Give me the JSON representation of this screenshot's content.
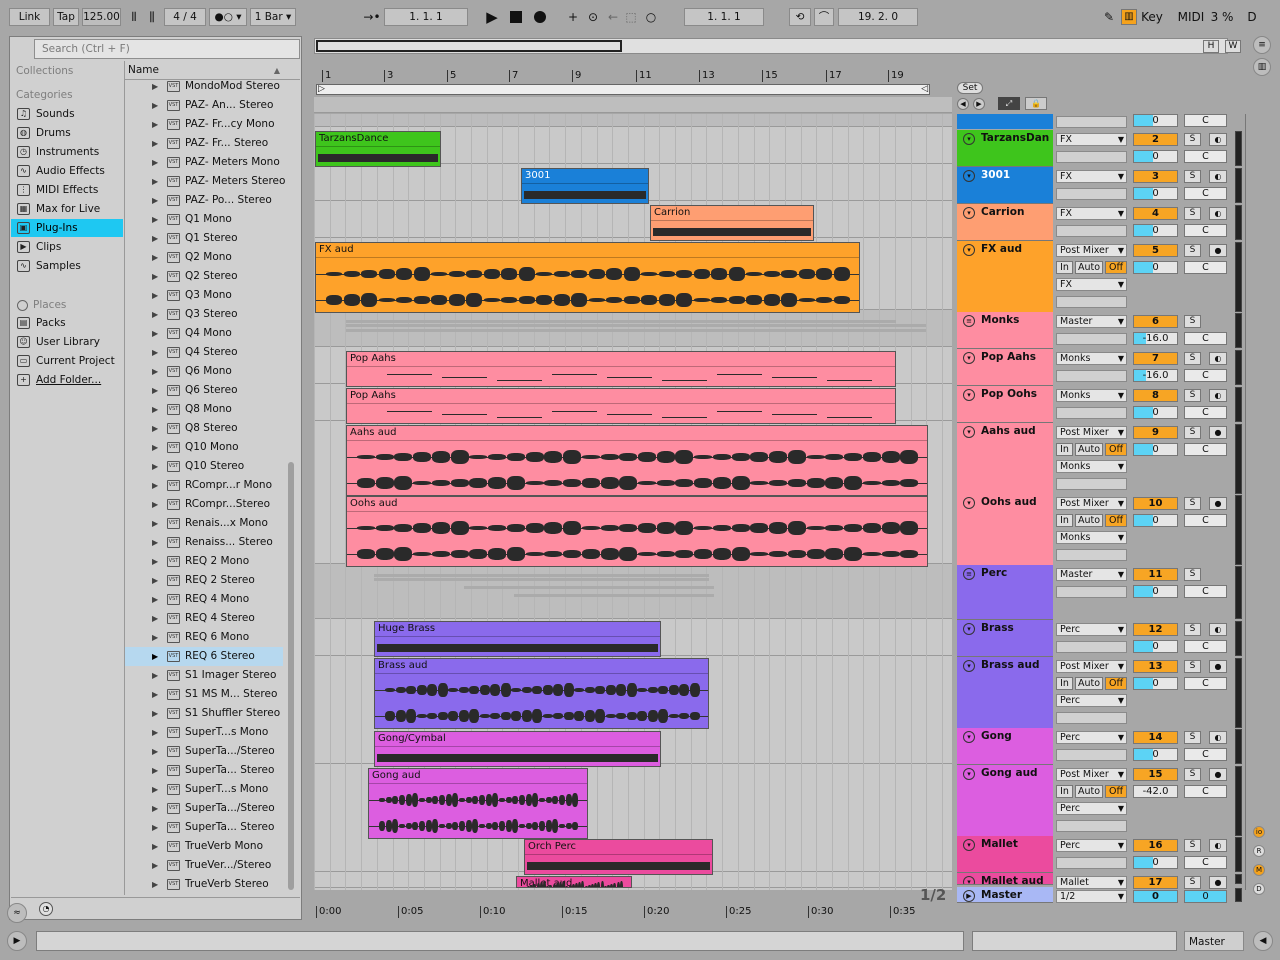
{
  "toolbar": {
    "link": "Link",
    "tap": "Tap",
    "tempo": "125.00",
    "meter_num": "4",
    "meter_den": "4",
    "quantize": "1 Bar",
    "position": "1.   1.   1",
    "loop_start": "1.   1.   1",
    "loop_length": "19.   2.   0",
    "key": "Key",
    "midi": "MIDI",
    "cpu": "3 %",
    "disk": "D"
  },
  "browser": {
    "search_placeholder": "Search (Ctrl + F)",
    "collections": "Collections",
    "categories_label": "Categories",
    "places_label": "Places",
    "name_header": "Name",
    "categories": [
      {
        "label": "Sounds",
        "icon": "note-icon"
      },
      {
        "label": "Drums",
        "icon": "drum-icon"
      },
      {
        "label": "Instruments",
        "icon": "clock-icon"
      },
      {
        "label": "Audio Effects",
        "icon": "wave-icon"
      },
      {
        "label": "MIDI Effects",
        "icon": "midi-icon"
      },
      {
        "label": "Max for Live",
        "icon": "grid-icon"
      },
      {
        "label": "Plug-Ins",
        "icon": "plugin-icon"
      },
      {
        "label": "Clips",
        "icon": "play-icon"
      },
      {
        "label": "Samples",
        "icon": "wave-icon"
      }
    ],
    "places": [
      {
        "label": "Packs",
        "icon": "box-icon"
      },
      {
        "label": "User Library",
        "icon": "user-icon"
      },
      {
        "label": "Current Project",
        "icon": "file-icon"
      },
      {
        "label": "Add Folder...",
        "icon": "plus-icon"
      }
    ],
    "plugin_badge": "VST",
    "items": [
      "MondoMod Stereo",
      "PAZ- An... Stereo",
      "PAZ- Fr...cy Mono",
      "PAZ- Fr... Stereo",
      "PAZ- Meters Mono",
      "PAZ- Meters Stereo",
      "PAZ- Po... Stereo",
      "Q1 Mono",
      "Q1 Stereo",
      "Q2 Mono",
      "Q2 Stereo",
      "Q3 Mono",
      "Q3 Stereo",
      "Q4 Mono",
      "Q4 Stereo",
      "Q6 Mono",
      "Q6 Stereo",
      "Q8 Mono",
      "Q8 Stereo",
      "Q10 Mono",
      "Q10 Stereo",
      "RCompr...r Mono",
      "RCompr...Stereo",
      "Renais...x Mono",
      "Renaiss... Stereo",
      "REQ 2 Mono",
      "REQ 2 Stereo",
      "REQ 4 Mono",
      "REQ 4 Stereo",
      "REQ 6 Mono",
      "REQ 6 Stereo",
      "S1 Imager Stereo",
      "S1 MS M... Stereo",
      "S1 Shuffler Stereo",
      "SuperT...s Mono",
      "SuperTa.../Stereo",
      "SuperTa... Stereo",
      "SuperT...s Mono",
      "SuperTa.../Stereo",
      "SuperTa... Stereo",
      "TrueVerb Mono",
      "TrueVer.../Stereo",
      "TrueVerb Stereo"
    ],
    "selected_item": "REQ 6 Stereo"
  },
  "arrangement": {
    "ruler": [
      "1",
      "3",
      "5",
      "7",
      "9",
      "11",
      "13",
      "15",
      "17",
      "19"
    ],
    "times": [
      "0:00",
      "0:05",
      "0:10",
      "0:15",
      "0:20",
      "0:25",
      "0:30",
      "0:35"
    ],
    "set_label": "Set",
    "page": "1/2",
    "h_btn": "H",
    "w_btn": "W"
  },
  "clips": [
    {
      "name": "TarzansDance",
      "color": "#3ec51c",
      "kind": "midi"
    },
    {
      "name": "3001",
      "color": "#1a80d8",
      "kind": "midi"
    },
    {
      "name": "Carrion",
      "color": "#fe9e72",
      "kind": "midi"
    },
    {
      "name": "FX aud",
      "color": "#fea22a",
      "kind": "audio"
    },
    {
      "name": "Pop Aahs",
      "color": "#fe8da1",
      "kind": "midi"
    },
    {
      "name": "Pop Aahs",
      "color": "#fe8da1",
      "kind": "midi"
    },
    {
      "name": "Aahs aud",
      "color": "#fe8da1",
      "kind": "audio"
    },
    {
      "name": "Oohs aud",
      "color": "#fe8da1",
      "kind": "audio"
    },
    {
      "name": "Huge Brass",
      "color": "#8a6aec",
      "kind": "midi"
    },
    {
      "name": "Brass aud",
      "color": "#8a6aec",
      "kind": "audio"
    },
    {
      "name": "Gong/Cymbal",
      "color": "#dc5ee0",
      "kind": "midi"
    },
    {
      "name": "Gong aud",
      "color": "#dc5ee0",
      "kind": "audio"
    },
    {
      "name": "Orch Perc",
      "color": "#eb4b9e",
      "kind": "midi"
    },
    {
      "name": "Mallet aud",
      "color": "#eb4b9e",
      "kind": "audio"
    }
  ],
  "tracks": [
    {
      "name": "TarzansDan",
      "color": "#3ec51c",
      "route": "FX",
      "num": "2",
      "vol": "0",
      "pan": "C"
    },
    {
      "name": "3001",
      "color": "#1a80d8",
      "route": "FX",
      "num": "3",
      "vol": "0",
      "pan": "C"
    },
    {
      "name": "Carrion",
      "color": "#fe9e72",
      "route": "FX",
      "num": "4",
      "vol": "0",
      "pan": "C"
    },
    {
      "name": "FX aud",
      "color": "#fea22a",
      "route": "Post Mixer",
      "num": "5",
      "vol": "0",
      "pan": "C",
      "out": "FX"
    },
    {
      "name": "Monks",
      "color": "#fe8da1",
      "route": "Master",
      "num": "6",
      "vol": "-16.0",
      "pan": "C"
    },
    {
      "name": "Pop Aahs",
      "color": "#fe8da1",
      "route": "Monks",
      "num": "7",
      "vol": "-16.0",
      "pan": "C"
    },
    {
      "name": "Pop Oohs",
      "color": "#fe8da1",
      "route": "Monks",
      "num": "8",
      "vol": "0",
      "pan": "C"
    },
    {
      "name": "Aahs aud",
      "color": "#fe8da1",
      "route": "Post Mixer",
      "num": "9",
      "vol": "0",
      "pan": "C",
      "out": "Monks"
    },
    {
      "name": "Oohs aud",
      "color": "#fe8da1",
      "route": "Post Mixer",
      "num": "10",
      "vol": "0",
      "pan": "C",
      "out": "Monks"
    },
    {
      "name": "Perc",
      "color": "#8a6aec",
      "route": "Master",
      "num": "11",
      "vol": "0",
      "pan": "C"
    },
    {
      "name": "Brass",
      "color": "#8a6aec",
      "route": "Perc",
      "num": "12",
      "vol": "0",
      "pan": "C"
    },
    {
      "name": "Brass aud",
      "color": "#8a6aec",
      "route": "Post Mixer",
      "num": "13",
      "vol": "0",
      "pan": "C",
      "out": "Perc"
    },
    {
      "name": "Gong",
      "color": "#dc5ee0",
      "route": "Perc",
      "num": "14",
      "vol": "0",
      "pan": "C"
    },
    {
      "name": "Gong aud",
      "color": "#dc5ee0",
      "route": "Post Mixer",
      "num": "15",
      "vol": "-42.0",
      "pan": "C",
      "out": "Perc"
    },
    {
      "name": "Mallet",
      "color": "#eb4b9e",
      "route": "Perc",
      "num": "16",
      "vol": "0",
      "pan": "C"
    },
    {
      "name": "Mallet aud",
      "color": "#eb4b9e",
      "route": "Mallet",
      "num": "17",
      "vol": "",
      "pan": ""
    },
    {
      "name": "Master",
      "color": "#a9b8f5",
      "route": "1/2",
      "num": "0",
      "vol": "0",
      "pan": ""
    }
  ],
  "monitor": {
    "in": "In",
    "auto": "Auto",
    "off": "Off"
  },
  "top_row": {
    "vol": "0",
    "pan": "C"
  },
  "status": {
    "master": "Master"
  }
}
